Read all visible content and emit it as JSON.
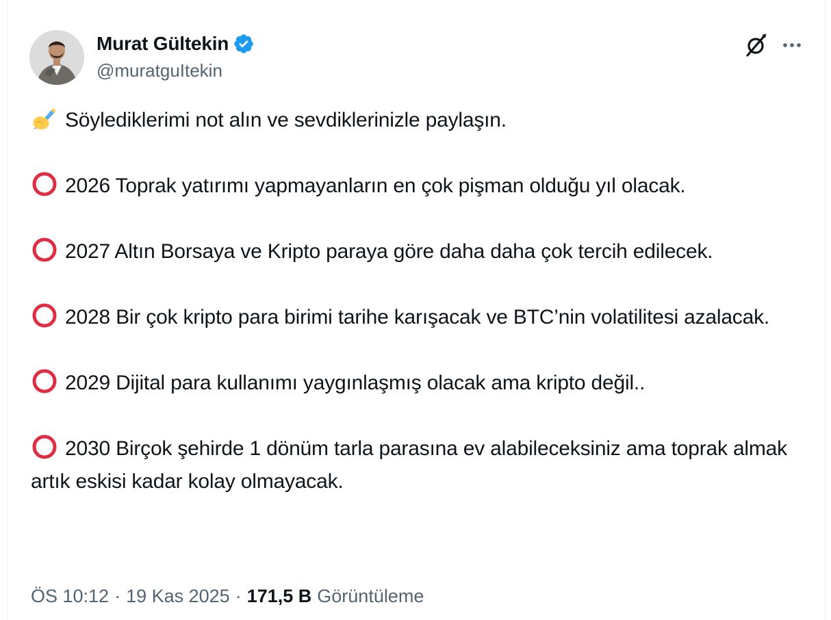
{
  "author": {
    "display_name": "Murat Gültekin",
    "handle": "@muratguItekin",
    "verified": true,
    "verified_color": "#1d9bf0"
  },
  "tweet": {
    "intro_icon": "writing-hand-emoji",
    "intro": "Söylediklerimi not alın ve sevdiklerinizle paylaşın.",
    "bullet_icon": "hollow-red-circle-emoji",
    "bullet_color": "#dd2e44",
    "items": [
      {
        "text": "2026 Toprak yatırımı yapmayanların en çok pişman olduğu yıl olacak."
      },
      {
        "text": "2027 Altın Borsaya ve Kripto paraya göre daha daha çok tercih edilecek."
      },
      {
        "text": "2028 Bir çok kripto para birimi tarihe karışacak ve BTC’nin volatilitesi azalacak."
      },
      {
        "text": "2029 Dijital para kullanımı yaygınlaşmış olacak ama kripto değil.."
      },
      {
        "text": "2030 Birçok şehirde 1 dönüm tarla parasına ev alabileceksiniz ama toprak almak artık eskisi kadar kolay olmayacak."
      }
    ]
  },
  "meta": {
    "time": "ÖS 10:12",
    "separator": "·",
    "date": "19 Kas 2025",
    "views_count": "171,5 B",
    "views_label": "Görüntüleme"
  },
  "actions": {
    "grok_icon": "grok-icon",
    "more_icon": "more-options-icon"
  }
}
